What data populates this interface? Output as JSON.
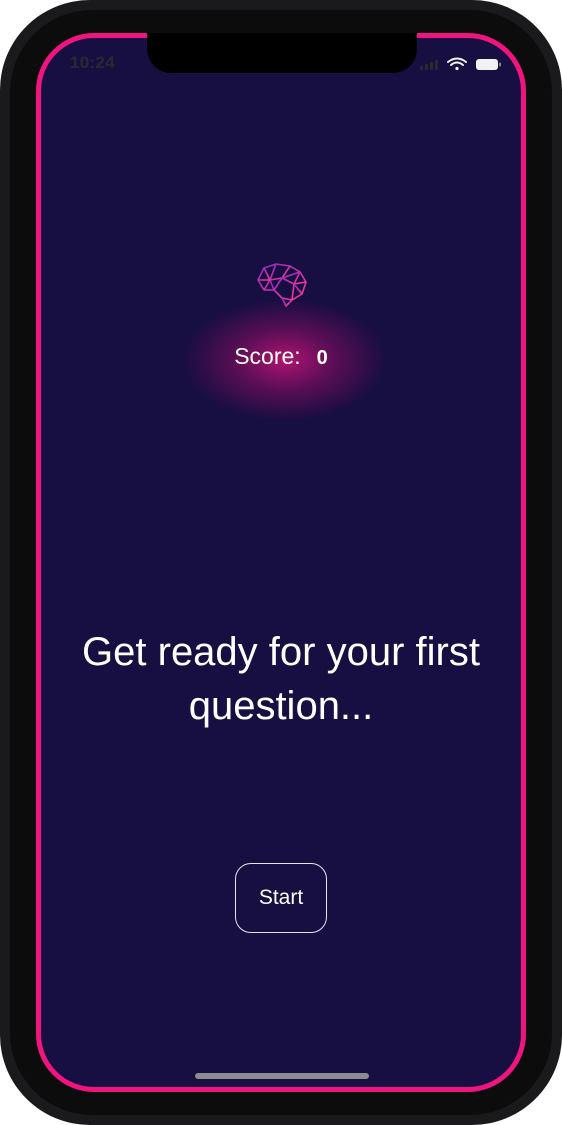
{
  "status_bar": {
    "time": "10:24",
    "icons": [
      "signal-icon",
      "wifi-icon",
      "battery-icon"
    ]
  },
  "header": {
    "logo_icon": "brain-icon",
    "score_label": "Score:",
    "score_value": "0"
  },
  "main": {
    "prompt": "Get ready for your first question..."
  },
  "actions": {
    "start_label": "Start"
  },
  "colors": {
    "background": "#170e41",
    "accent_border": "#f0157e",
    "glow": "#c81478",
    "text": "#ffffff"
  }
}
